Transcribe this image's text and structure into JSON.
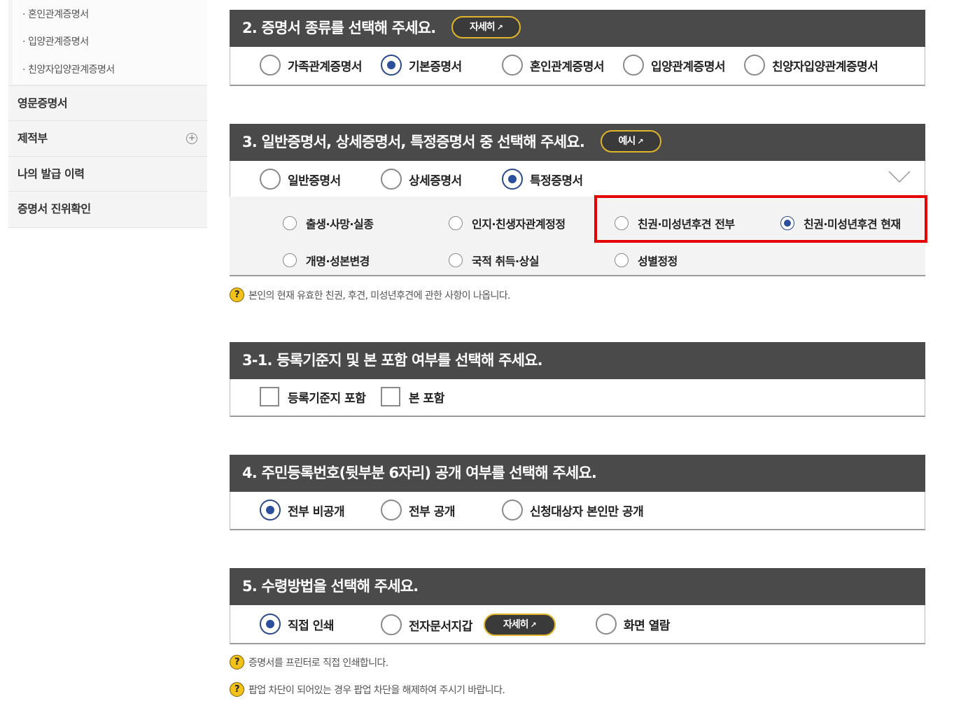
{
  "sidebar": {
    "submenu": [
      "혼인관계증명서",
      "입양관계증명서",
      "친양자입양관계증명서"
    ],
    "items": [
      {
        "label": "영문증명서"
      },
      {
        "label": "제적부"
      },
      {
        "label": "나의 발급 이력"
      },
      {
        "label": "증명서 진위확인"
      }
    ]
  },
  "sec2": {
    "title": "2. 증명서 종류를 선택해 주세요.",
    "button": "자세히",
    "options": [
      "가족관계증명서",
      "기본증명서",
      "혼인관계증명서",
      "입양관계증명서",
      "친양자입양관계증명서"
    ],
    "selected": "기본증명서"
  },
  "sec3": {
    "title": "3. 일반증명서, 상세증명서, 특정증명서 중 선택해 주세요.",
    "button": "예시",
    "options": [
      "일반증명서",
      "상세증명서",
      "특정증명서"
    ],
    "selected": "특정증명서",
    "sub_options": [
      "출생·사망·실종",
      "인지·친생자관계정정",
      "친권·미성년후견 전부",
      "친권·미성년후견 현재",
      "개명·성본변경",
      "국적 취득·상실",
      "성별정정"
    ],
    "sub_selected": "친권·미성년후견 현재",
    "note": "본인의 현재 유효한 친권, 후견, 미성년후견에 관한 사항이 나옵니다."
  },
  "sec31": {
    "title": "3-1. 등록기준지 및 본 포함 여부를 선택해 주세요.",
    "checkboxes": [
      "등록기준지 포함",
      "본 포함"
    ]
  },
  "sec4": {
    "title": "4. 주민등록번호(뒷부분 6자리) 공개 여부를 선택해 주세요.",
    "options": [
      "전부 비공개",
      "전부 공개",
      "신청대상자 본인만 공개"
    ],
    "selected": "전부 비공개"
  },
  "sec5": {
    "title": "5. 수령방법을 선택해 주세요.",
    "options": [
      "직접 인쇄",
      "전자문서지갑",
      "화면 열람"
    ],
    "button": "자세히",
    "selected": "직접 인쇄",
    "notes": [
      "증명서를 프린터로 직접 인쇄합니다.",
      "팝업 차단이 되어있는 경우 팝업 차단을 해제하여 주시기 바랍니다."
    ]
  },
  "icons": {
    "note": "question-mark-icon",
    "external": "external-link-icon",
    "expand": "chevron-down-icon",
    "add": "plus-circle-icon"
  },
  "colors": {
    "header_bg": "#4a4a4a",
    "radio_selected": "#2c4f9c",
    "pill_border": "#e0b52a",
    "highlight": "#e60000",
    "note_icon": "#f2c21a"
  }
}
